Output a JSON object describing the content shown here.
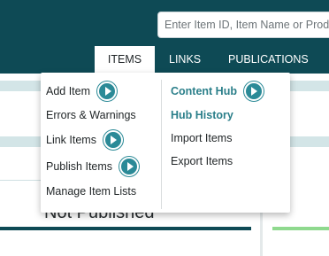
{
  "header": {
    "search_placeholder": "Enter Item ID, Item Name or Product ID",
    "tabs": [
      {
        "label": "ITEMS",
        "active": true
      },
      {
        "label": "LINKS",
        "active": false
      },
      {
        "label": "PUBLICATIONS",
        "active": false
      }
    ]
  },
  "page": {
    "status_text": "Not Published"
  },
  "menu": {
    "left": [
      {
        "label": "Add Item",
        "has_action_icon": true
      },
      {
        "label": "Errors & Warnings",
        "has_action_icon": false
      },
      {
        "label": "Link Items",
        "has_action_icon": true
      },
      {
        "label": "Publish Items",
        "has_action_icon": true
      },
      {
        "label": "Manage Item Lists",
        "has_action_icon": false
      }
    ],
    "right": [
      {
        "label": "Content Hub",
        "has_action_icon": true,
        "highlighted": true
      },
      {
        "label": "Hub History",
        "has_action_icon": false,
        "highlighted": true
      },
      {
        "label": "Import Items",
        "has_action_icon": false
      },
      {
        "label": "Export Items",
        "has_action_icon": false
      }
    ]
  },
  "colors": {
    "header_bg": "#0e4a55",
    "accent": "#2b7f8a",
    "play_icon": "#2b8a97",
    "band": "#d3e5e7",
    "status_green": "#8fd98e"
  }
}
